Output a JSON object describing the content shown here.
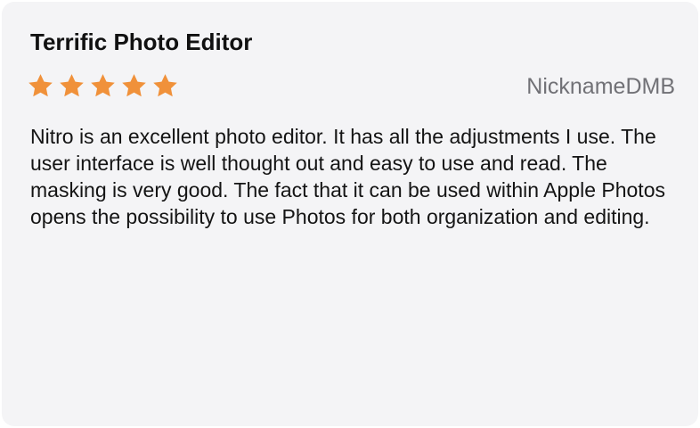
{
  "review": {
    "title": "Terrific Photo Editor",
    "rating": 5,
    "rating_max": 5,
    "star_color": "#f0913a",
    "author": "NicknameDMB",
    "body": "Nitro is an excellent photo editor. It has all the adjustments I use. The user interface is well thought out and easy to use and read. The masking is very good. The fact that it can be used within Apple Photos opens the possibility to use Photos for both organization and editing."
  }
}
